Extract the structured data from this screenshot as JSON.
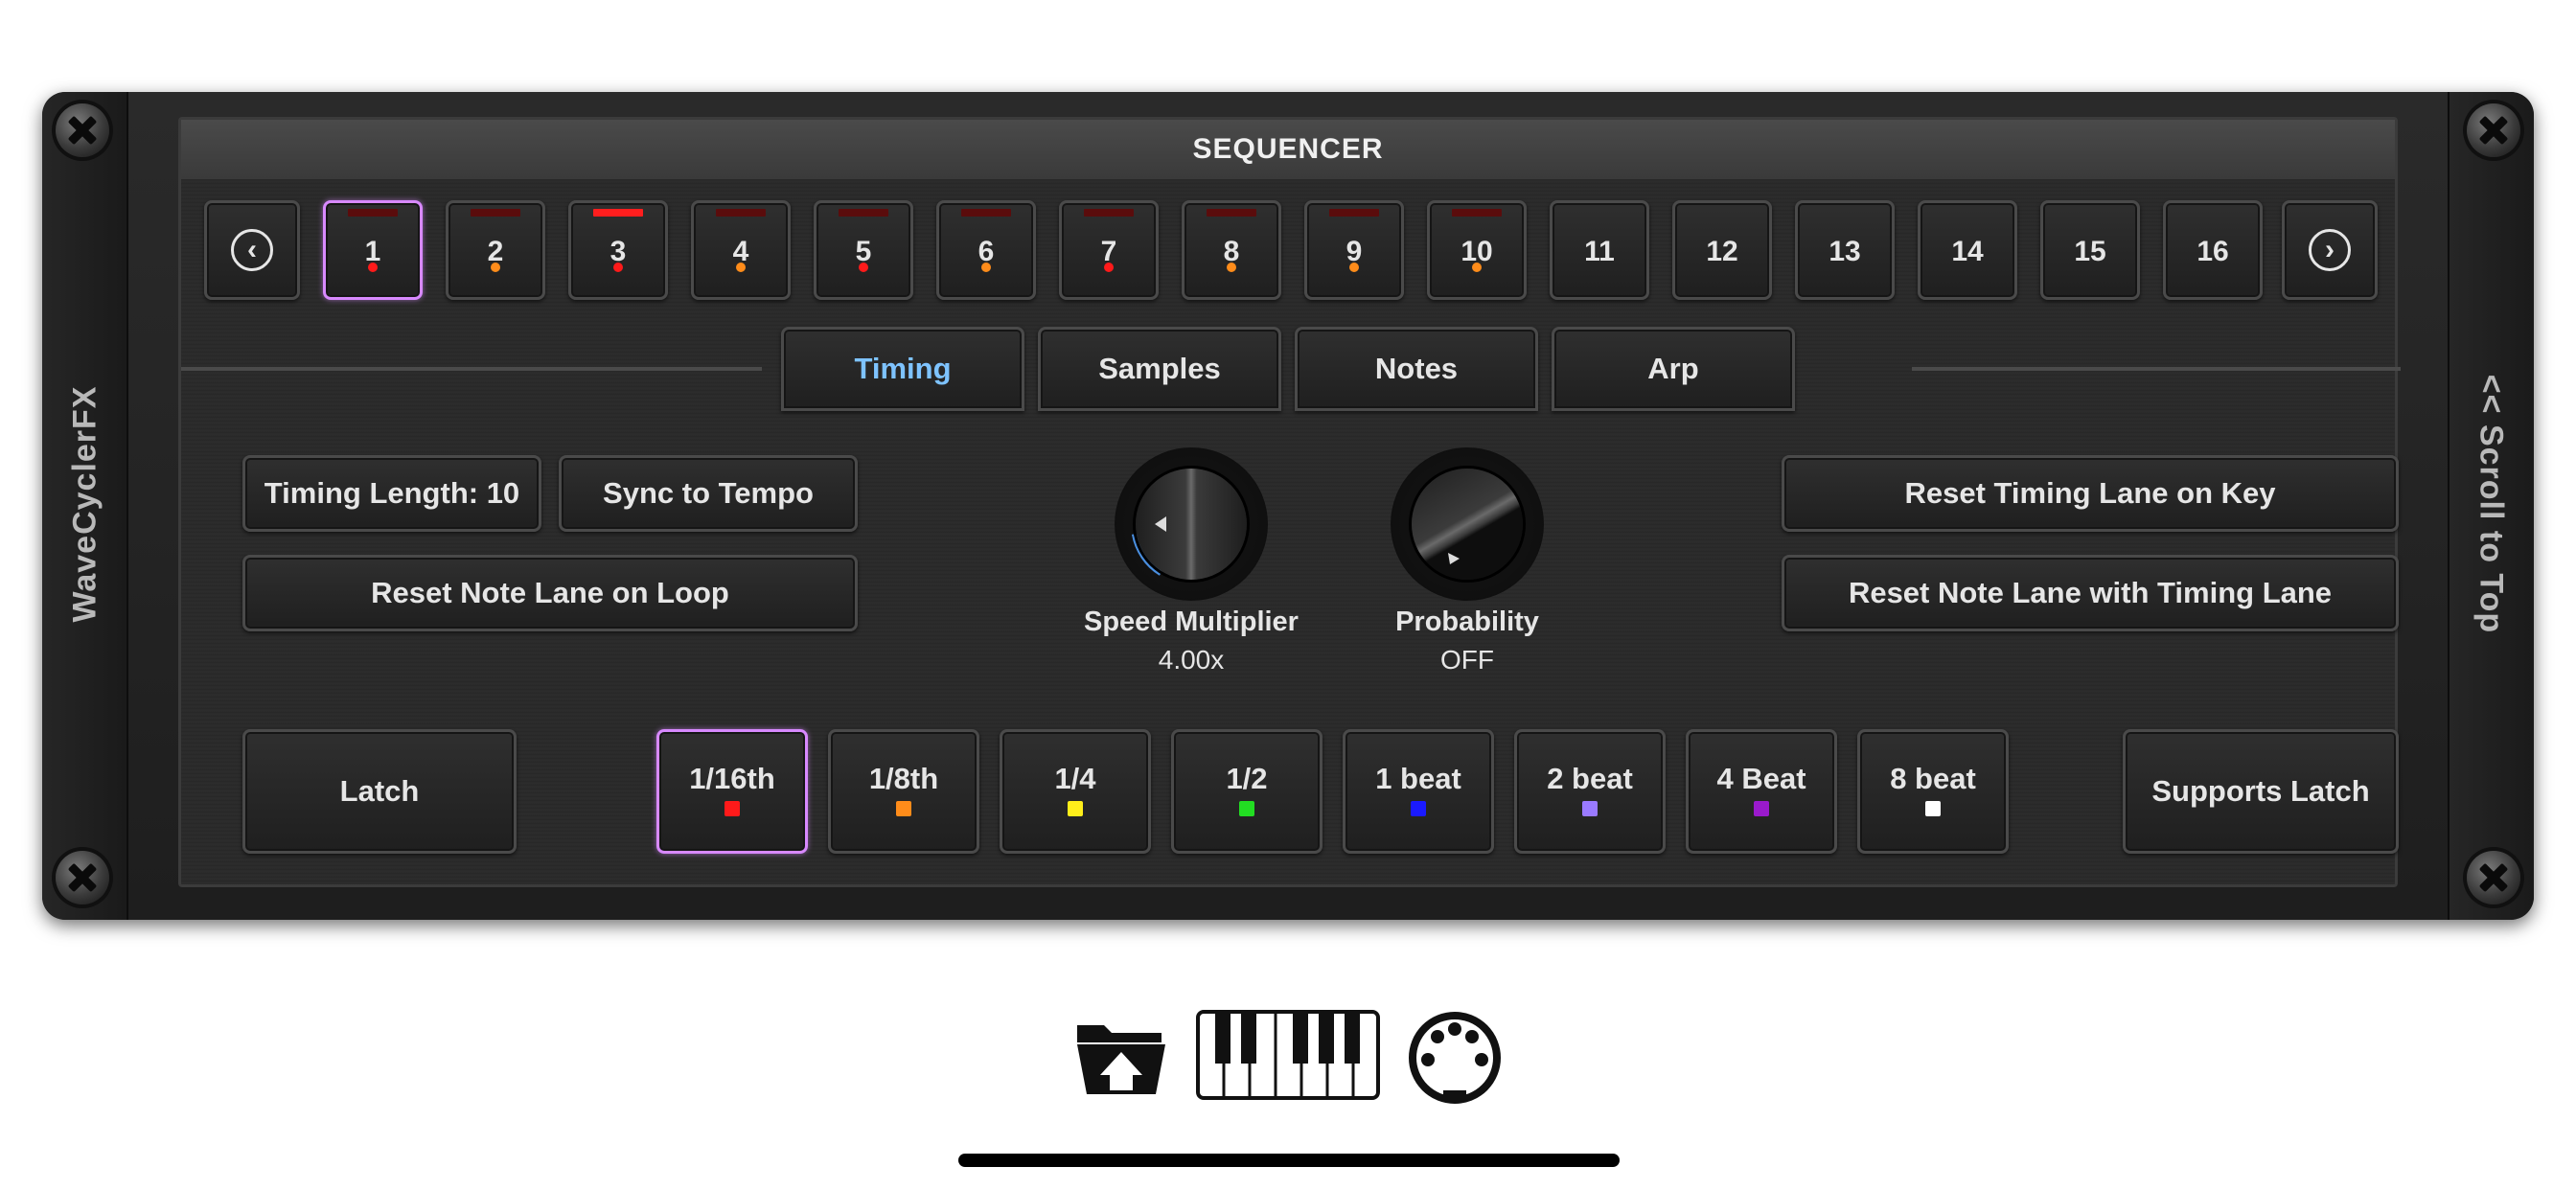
{
  "plugin": {
    "name": "WaveCyclerFX",
    "scroll_label": "<< Scroll to Top",
    "panel_title": "SEQUENCER"
  },
  "steps": [
    {
      "label": "1",
      "bar": "dim",
      "dot": "#ff1a1a",
      "selected": true
    },
    {
      "label": "2",
      "bar": "dim",
      "dot": "#ff8c1a",
      "selected": false
    },
    {
      "label": "3",
      "bar": "on",
      "dot": "#ff1a1a",
      "selected": false
    },
    {
      "label": "4",
      "bar": "dim",
      "dot": "#ff8c1a",
      "selected": false
    },
    {
      "label": "5",
      "bar": "dim",
      "dot": "#ff1a1a",
      "selected": false
    },
    {
      "label": "6",
      "bar": "dim",
      "dot": "#ff8c1a",
      "selected": false
    },
    {
      "label": "7",
      "bar": "dim",
      "dot": "#ff1a1a",
      "selected": false
    },
    {
      "label": "8",
      "bar": "dim",
      "dot": "#ff8c1a",
      "selected": false
    },
    {
      "label": "9",
      "bar": "dim",
      "dot": "#ff8c1a",
      "selected": false
    },
    {
      "label": "10",
      "bar": "dim",
      "dot": "#ff8c1a",
      "selected": false
    },
    {
      "label": "11",
      "bar": "",
      "dot": "",
      "selected": false
    },
    {
      "label": "12",
      "bar": "",
      "dot": "",
      "selected": false
    },
    {
      "label": "13",
      "bar": "",
      "dot": "",
      "selected": false
    },
    {
      "label": "14",
      "bar": "",
      "dot": "",
      "selected": false
    },
    {
      "label": "15",
      "bar": "",
      "dot": "",
      "selected": false
    },
    {
      "label": "16",
      "bar": "",
      "dot": "",
      "selected": false
    }
  ],
  "nav": {
    "prev_icon": "chevron-left-circle-icon",
    "next_icon": "chevron-right-circle-icon"
  },
  "tabs": [
    {
      "label": "Timing",
      "active": true
    },
    {
      "label": "Samples",
      "active": false
    },
    {
      "label": "Notes",
      "active": false
    },
    {
      "label": "Arp",
      "active": false
    }
  ],
  "controls": {
    "timing_length": "Timing Length: 10",
    "sync_to_tempo": "Sync to Tempo",
    "reset_note_lane_on_loop": "Reset Note Lane on Loop",
    "reset_timing_lane_on_key": "Reset Timing Lane on Key",
    "reset_note_lane_with_timing_lane": "Reset Note Lane with Timing Lane",
    "latch": "Latch",
    "supports_latch": "Supports Latch"
  },
  "knobs": [
    {
      "label": "Speed Multiplier",
      "value": "4.00x",
      "accent": "#4a8fe0"
    },
    {
      "label": "Probability",
      "value": "OFF",
      "accent": ""
    }
  ],
  "rates": [
    {
      "label": "1/16th",
      "color": "#ff1a1a",
      "selected": true
    },
    {
      "label": "1/8th",
      "color": "#ff8c1a",
      "selected": false
    },
    {
      "label": "1/4",
      "color": "#ffee1a",
      "selected": false
    },
    {
      "label": "1/2",
      "color": "#22dd22",
      "selected": false
    },
    {
      "label": "1 beat",
      "color": "#1a1aff",
      "selected": false
    },
    {
      "label": "2 beat",
      "color": "#9a7aff",
      "selected": false
    },
    {
      "label": "4 Beat",
      "color": "#9a1acc",
      "selected": false
    },
    {
      "label": "8 beat",
      "color": "#ffffff",
      "selected": false
    }
  ],
  "toolbar_icons": [
    "folder-open-icon",
    "piano-keyboard-icon",
    "midi-connector-icon"
  ]
}
